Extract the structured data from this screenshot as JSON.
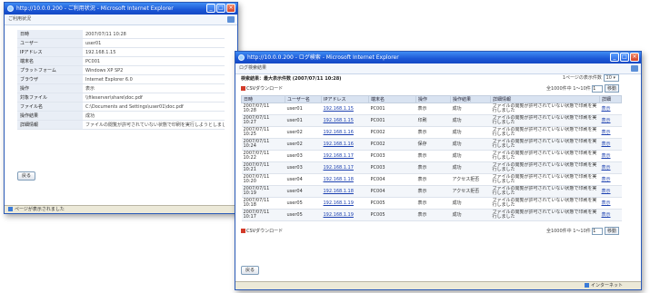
{
  "window1": {
    "title": "http://10.0.0.200 - ご利用状況 - Microsoft Internet Explorer",
    "page_header": "ご利用状況",
    "fields": [
      {
        "label": "日時",
        "value": "2007/07/11 10:28"
      },
      {
        "label": "ユーザー",
        "value": "user01"
      },
      {
        "label": "IPアドレス",
        "value": "192.168.1.15"
      },
      {
        "label": "端末名",
        "value": "PC001"
      },
      {
        "label": "プラットフォーム",
        "value": "Windows XP SP2"
      },
      {
        "label": "ブラウザ",
        "value": "Internet Explorer 6.0"
      },
      {
        "label": "操作",
        "value": "表示"
      },
      {
        "label": "対象ファイル",
        "value": "\\\\fileserver\\share\\doc.pdf"
      },
      {
        "label": "ファイル名",
        "value": "C:\\Documents and Settings\\user01\\doc.pdf"
      },
      {
        "label": "操作結果",
        "value": "成功"
      },
      {
        "label": "詳細情報",
        "value": "ファイルの閲覧が許可されていない状態で印刷を実行しようとしました"
      }
    ],
    "back_button": "戻る",
    "status_text": "ページが表示されました"
  },
  "window2": {
    "title": "http://10.0.0.200 - ログ検索 - Microsoft Internet Explorer",
    "page_header": "ログ検索結果",
    "summary": "検索結果：最大表示件数 (2007/07/11 10:28)",
    "page_size_label": "1ページの表示件数",
    "page_size_value": "10",
    "csv_label": "CSVダウンロード",
    "pager_info": "全1000件中 1〜10件",
    "pager_page": "1",
    "pager_go": "移動",
    "columns": [
      "日時",
      "ユーザー名",
      "IPアドレス",
      "端末名",
      "操作",
      "操作結果",
      "詳細情報",
      "詳細"
    ],
    "rows": [
      [
        "2007/07/11 10:28",
        "user01",
        "192.168.1.15",
        "PC001",
        "表示",
        "成功",
        "ファイルの閲覧が許可されていない状態で印刷を実行しました",
        "表示"
      ],
      [
        "2007/07/11 10:27",
        "user01",
        "192.168.1.15",
        "PC001",
        "印刷",
        "成功",
        "ファイルの閲覧が許可されていない状態で印刷を実行しました",
        "表示"
      ],
      [
        "2007/07/11 10:25",
        "user02",
        "192.168.1.16",
        "PC002",
        "表示",
        "成功",
        "ファイルの閲覧が許可されていない状態で印刷を実行しました",
        "表示"
      ],
      [
        "2007/07/11 10:24",
        "user02",
        "192.168.1.16",
        "PC002",
        "保存",
        "成功",
        "ファイルの閲覧が許可されていない状態で印刷を実行しました",
        "表示"
      ],
      [
        "2007/07/11 10:22",
        "user03",
        "192.168.1.17",
        "PC003",
        "表示",
        "成功",
        "ファイルの閲覧が許可されていない状態で印刷を実行しました",
        "表示"
      ],
      [
        "2007/07/11 10:21",
        "user03",
        "192.168.1.17",
        "PC003",
        "表示",
        "成功",
        "ファイルの閲覧が許可されていない状態で印刷を実行しました",
        "表示"
      ],
      [
        "2007/07/11 10:20",
        "user04",
        "192.168.1.18",
        "PC004",
        "表示",
        "アクセス拒否",
        "ファイルの閲覧が許可されていない状態で印刷を実行しました",
        "表示"
      ],
      [
        "2007/07/11 10:19",
        "user04",
        "192.168.1.18",
        "PC004",
        "表示",
        "アクセス拒否",
        "ファイルの閲覧が許可されていない状態で印刷を実行しました",
        "表示"
      ],
      [
        "2007/07/11 10:18",
        "user05",
        "192.168.1.19",
        "PC005",
        "表示",
        "成功",
        "ファイルの閲覧が許可されていない状態で印刷を実行しました",
        "表示"
      ],
      [
        "2007/07/11 10:17",
        "user05",
        "192.168.1.19",
        "PC005",
        "表示",
        "成功",
        "ファイルの閲覧が許可されていない状態で印刷を実行しました",
        "表示"
      ]
    ],
    "back_button": "戻る",
    "status_zone": "インターネット"
  }
}
